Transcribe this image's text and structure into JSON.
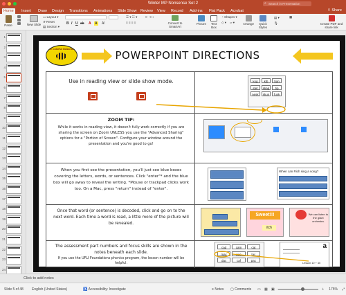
{
  "window": {
    "title": "Winter MP Nonsense Set 2",
    "search_placeholder": "Search in Presentation"
  },
  "menu": {
    "tabs": [
      "Home",
      "Insert",
      "Draw",
      "Design",
      "Transitions",
      "Animations",
      "Slide Show",
      "Review",
      "View",
      "Record",
      "Add-ins",
      "Flat Pack",
      "Acrobat"
    ],
    "active": "Home",
    "share": "Share"
  },
  "ribbon": {
    "paste": "Paste",
    "new_slide": "New Slide",
    "layout": "Layout",
    "reset": "Reset",
    "section": "Section",
    "convert_smartart": "Convert to SmartArt",
    "picture": "Picture",
    "text_box": "Text Box",
    "shapes": "Shapes",
    "arrange": "Arrange",
    "quick_styles": "Quick Styles",
    "create_pdf": "Create PDF and share link"
  },
  "slides_panel": {
    "numbers": [
      "1",
      "2",
      "3",
      "4",
      "5",
      "6",
      "7",
      "8",
      "9",
      "10",
      "11",
      "12",
      "13",
      "14",
      "15",
      "16",
      "17",
      "18",
      "19",
      "20",
      "21",
      "22",
      "23",
      "24",
      "25"
    ],
    "selected": "5"
  },
  "slide": {
    "logo_text": "The Colorful Classroom",
    "title": "POWERPOINT DIRECTIONS",
    "rows": [
      {
        "text": "Use in reading view or slide show mode.",
        "words": [
          "kog",
          "kib",
          "ban",
          "stet",
          "skap",
          "tip",
          "nesk",
          "skun",
          "fusk"
        ]
      },
      {
        "zoom_heading": "ZOOM TIP:",
        "text": "While it works in reading view, it doesn't fully work correctly if you are sharing the screen on Zoom UNLESS you use the \"Advanced Sharing\" options for a \"Portion of Screen\". Configure your window around the presentation and you're good to go!"
      },
      {
        "text": "When you first see the presentation, you'll just see blue boxes covering the letters, words, or sentences. Click \"enter\"* and the blue box will go away to reveal the writing. *Mouse or trackpad clicks work too. On a Mac, press \"return\" instead of \"enter\".",
        "thumb_question": "When can Rich sing a song?"
      },
      {
        "text": "Once that word (or sentence) is decoded, click and go on to the next word. Each time a word is read, a little more of the picture will be revealed.",
        "thumb_words": [
          "Sweet!!!",
          "itch",
          "We can listen to the giant orchestra."
        ]
      },
      {
        "text": "The assessment part numbers and focus skills are shown in the notes beneath each slide.",
        "note": "If you use the UFLI Foundations phonics program, the lesson number will be helpful.",
        "words": [
          "cad",
          "cam",
          "cat",
          "mac",
          "pac",
          "tac",
          "dac",
          "caf",
          "pac"
        ],
        "lesson": "Lesson 10 + 40"
      }
    ]
  },
  "notes": {
    "placeholder": "Click to add notes"
  },
  "status": {
    "slide": "Slide 5 of 48",
    "language": "English (United States)",
    "accessibility": "Accessibility: Investigate",
    "notes": "Notes",
    "comments": "Comments",
    "zoom": "175%"
  },
  "colors": {
    "titlebar": "#b7472a",
    "accent_arrow": "#f4c61f",
    "blue_box": "#5b87c2",
    "ppt_red": "#c43e1c"
  }
}
